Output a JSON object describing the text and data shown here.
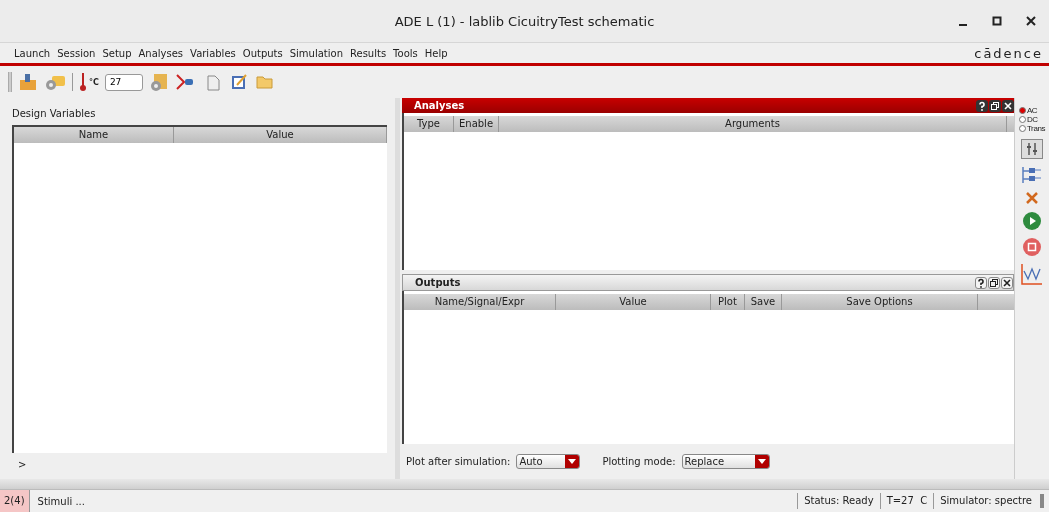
{
  "window": {
    "title": "ADE L (1) - lablib CicuitryTest schematic"
  },
  "menu": [
    "Launch",
    "Session",
    "Setup",
    "Analyses",
    "Variables",
    "Outputs",
    "Simulation",
    "Results",
    "Tools",
    "Help"
  ],
  "logo": "cādence",
  "toolbar": {
    "temperature_unit": "°C",
    "temperature": "27"
  },
  "design_variables": {
    "title": "Design Variables",
    "columns": [
      "Name",
      "Value"
    ],
    "prompt": ">"
  },
  "analyses": {
    "title": "Analyses",
    "columns": [
      "Type",
      "Enable",
      "Arguments"
    ]
  },
  "outputs": {
    "title": "Outputs",
    "columns": [
      "Name/Signal/Expr",
      "Value",
      "Plot",
      "Save",
      "Save Options"
    ],
    "plot_after_label": "Plot after simulation:",
    "plot_after": "Auto",
    "plotting_mode_label": "Plotting mode:",
    "plotting_mode": "Replace"
  },
  "analysis_types": [
    {
      "label": "AC",
      "selected": true
    },
    {
      "label": "DC",
      "selected": false
    },
    {
      "label": "Trans",
      "selected": false
    }
  ],
  "status_bar": {
    "count": "2(4)",
    "message": "Stimuli ...",
    "status": "Status: Ready",
    "temperature": "T=27  C",
    "simulator": "Simulator: spectre"
  }
}
